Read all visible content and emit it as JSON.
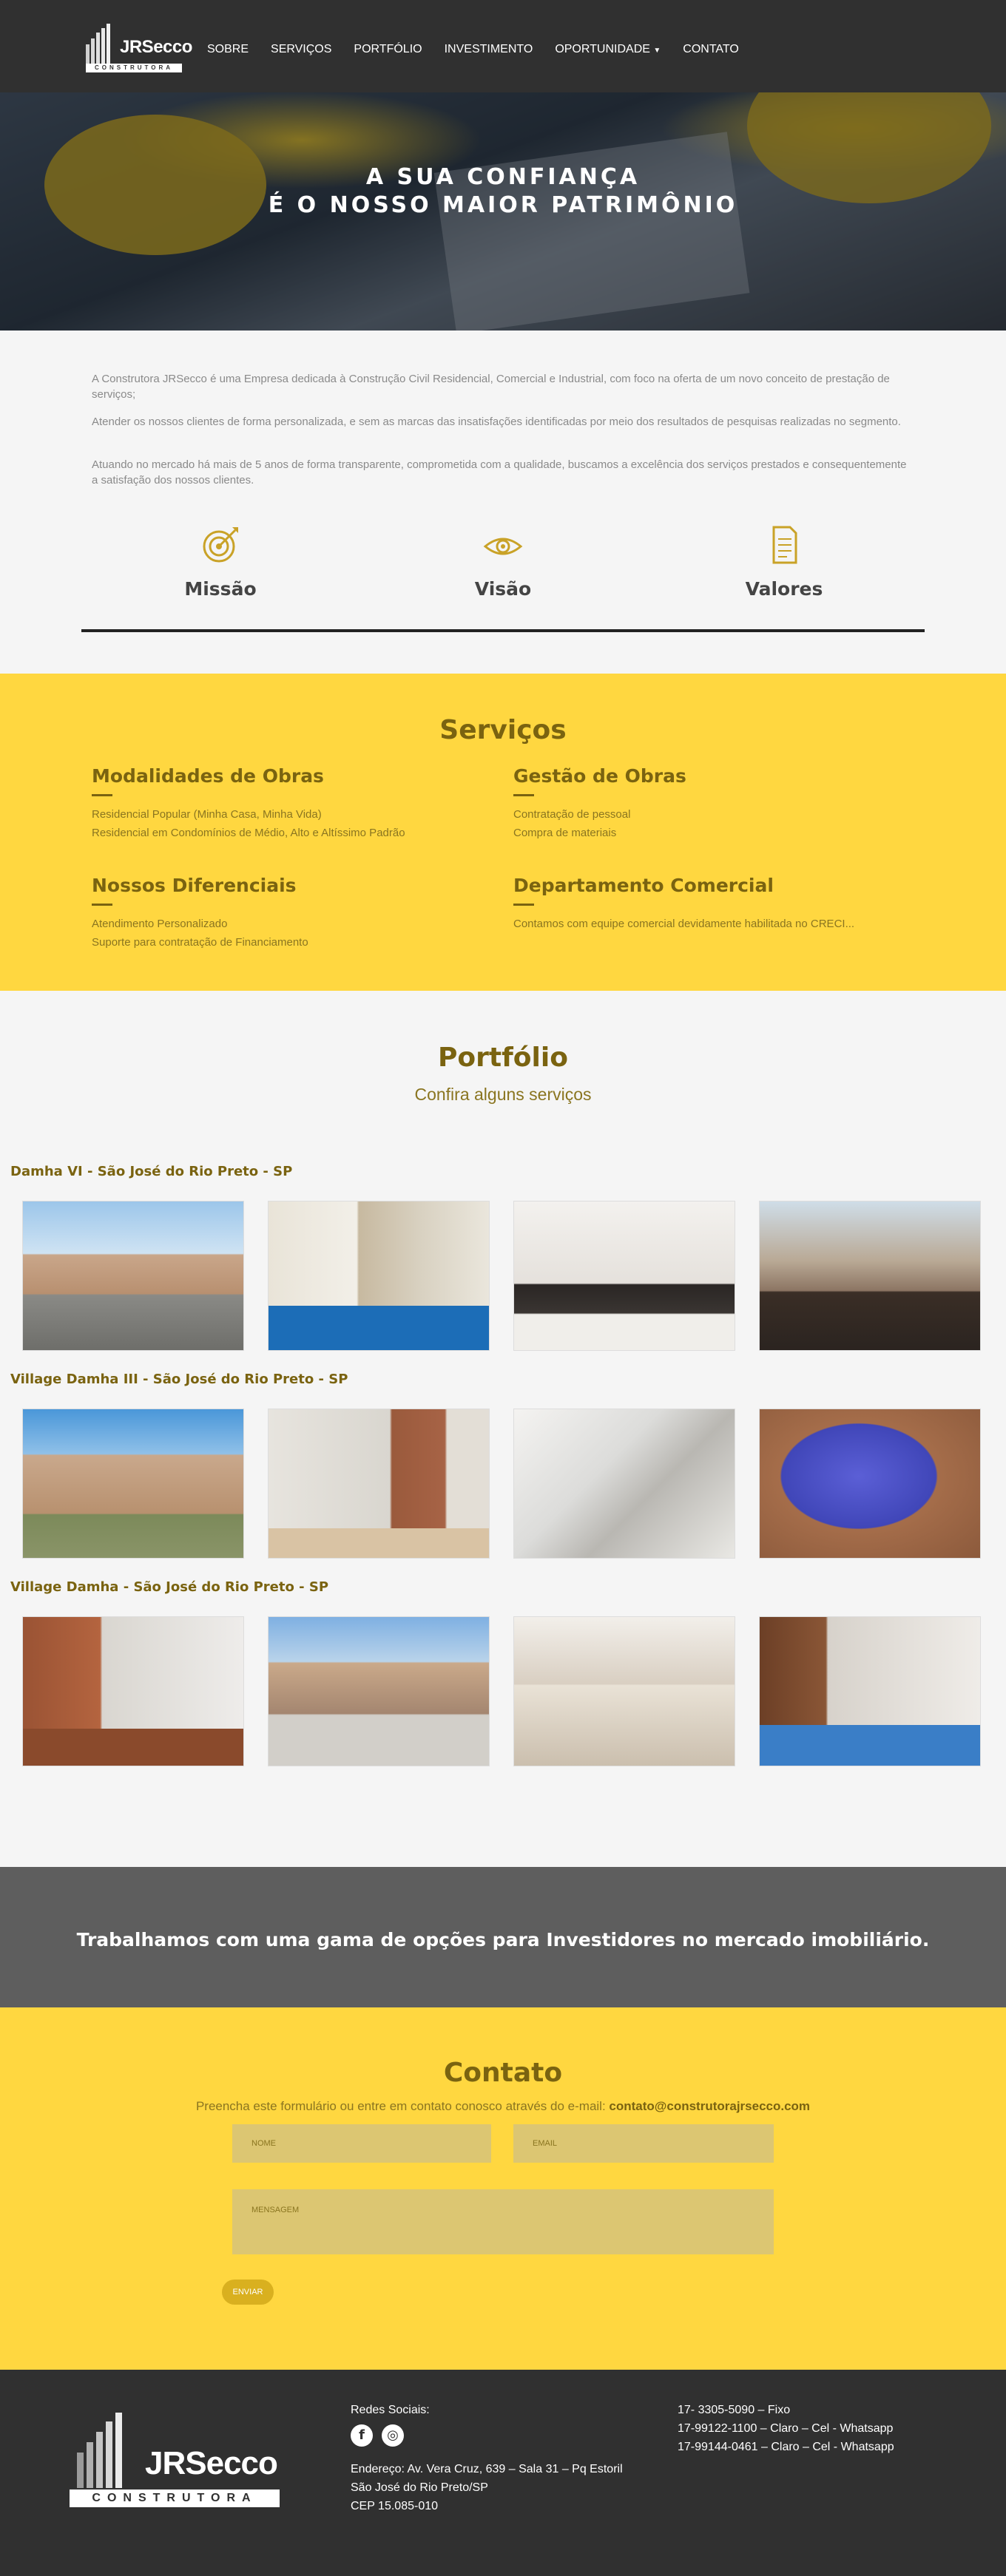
{
  "nav": {
    "logo_name": "JRSecco",
    "logo_sub": "CONSTRUTORA",
    "items": [
      "SOBRE",
      "SERVIÇOS",
      "PORTFÓLIO",
      "INVESTIMENTO",
      "OPORTUNIDADE",
      "CONTATO"
    ]
  },
  "hero": {
    "line1": "A SUA CONFIANÇA",
    "line2": "É O NOSSO MAIOR PATRIMÔNIO"
  },
  "about": {
    "p1": "A Construtora JRSecco é uma Empresa dedicada à Construção Civil Residencial, Comercial e Industrial, com foco na oferta de um novo conceito de prestação de serviços;",
    "p2": "Atender os nossos clientes de forma personalizada, e sem as marcas das insatisfações identificadas por meio dos resultados de pesquisas realizadas no segmento.",
    "p3": "Atuando no mercado há mais de 5 anos de forma transparente, comprometida com a qualidade, buscamos a excelência dos serviços prestados e consequentemente a satisfação dos nossos clientes.",
    "features": [
      {
        "label": "Missão",
        "icon": "target-icon"
      },
      {
        "label": "Visão",
        "icon": "eye-icon"
      },
      {
        "label": "Valores",
        "icon": "document-icon"
      }
    ]
  },
  "services": {
    "title": "Serviços",
    "items": [
      {
        "title": "Modalidades de Obras",
        "lines": [
          "Residencial Popular (Minha Casa, Minha Vida)",
          "Residencial em Condomínios de Médio, Alto e Altíssimo Padrão"
        ]
      },
      {
        "title": "Gestão de Obras",
        "lines": [
          "Contratação de pessoal",
          "Compra de materiais"
        ]
      },
      {
        "title": "Nossos Diferenciais",
        "lines": [
          "Atendimento Personalizado",
          "Suporte para contratação de Financiamento"
        ]
      },
      {
        "title": "Departamento Comercial",
        "lines": [
          "Contamos com equipe comercial devidamente habilitada no CRECI..."
        ]
      }
    ]
  },
  "portfolio": {
    "title": "Portfólio",
    "subtitle": "Confira alguns serviços",
    "galleries": [
      "Damha VI - São José do Rio Preto - SP",
      "Village Damha III - São José do Rio Preto - SP",
      "Village Damha - São José do Rio Preto - SP"
    ]
  },
  "invest": {
    "text": "Trabalhamos com uma gama de opções para Investidores no mercado imobiliário."
  },
  "contact": {
    "title": "Contato",
    "lead": "Preencha este formulário ou entre em contato conosco através do e-mail: ",
    "email": "contato@construtorajrsecco.com",
    "name_placeholder": "NOME",
    "email_placeholder": "EMAIL",
    "message_placeholder": "MENSAGEM",
    "send": "ENVIAR"
  },
  "footer": {
    "social_label": "Redes Sociais:",
    "address1": "Endereço: Av. Vera Cruz, 639 – Sala 31 – Pq Estoril",
    "address2": "São José do Rio Preto/SP",
    "address3": "CEP 15.085-010",
    "phone1": "17- 3305-5090 – Fixo",
    "phone2": "17-99122-1100 – Claro – Cel - Whatsapp",
    "phone3": "17-99144-0461 – Claro – Cel - Whatsapp"
  },
  "colors": {
    "accent_yellow": "#ffd740",
    "dark": "#303030",
    "olive": "#7a6310"
  }
}
